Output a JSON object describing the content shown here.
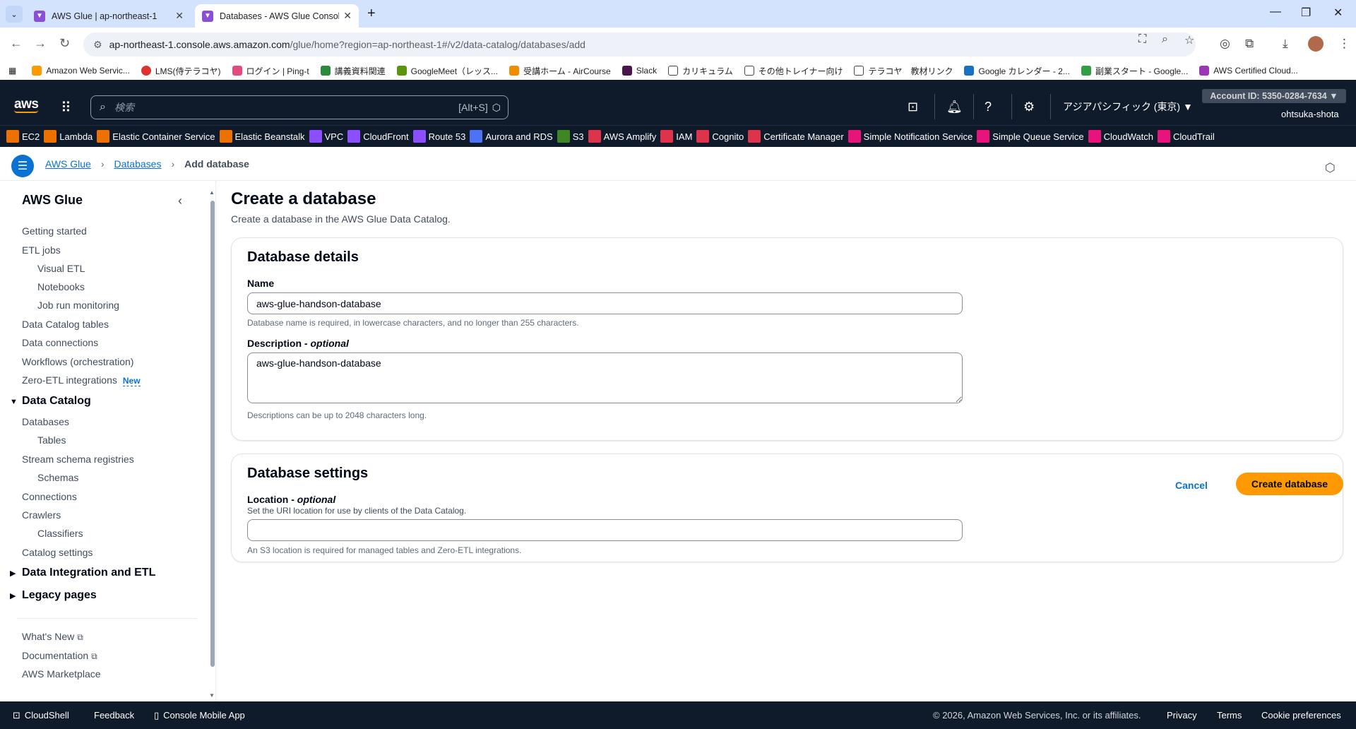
{
  "browser": {
    "tabs": [
      {
        "label": "AWS Glue | ap-northeast-1",
        "active": false
      },
      {
        "label": "Databases - AWS Glue Console",
        "active": true
      }
    ],
    "url_host": "ap-northeast-1.console.aws.amazon.com",
    "url_path": "/glue/home?region=ap-northeast-1#/v2/data-catalog/databases/add",
    "bookmarks": [
      {
        "label": "Amazon Web Servic...",
        "color": "#ff9900"
      },
      {
        "label": "LMS(侍テラコヤ)",
        "color": "#e03131"
      },
      {
        "label": "ログイン | Ping-t",
        "color": "#e64980"
      },
      {
        "label": "講義資料関連",
        "color": "#2b8a3e"
      },
      {
        "label": "GoogleMeet（レッス...",
        "color": "#5c940d"
      },
      {
        "label": "受講ホーム - AirCourse",
        "color": "#f08c00"
      },
      {
        "label": "Slack",
        "color": "#4a154b"
      },
      {
        "label": "カリキュラム",
        "color": "#ffffff"
      },
      {
        "label": "その他トレイナー向け",
        "color": "#ffffff"
      },
      {
        "label": "テラコヤ　教材リンク",
        "color": "#ffffff"
      },
      {
        "label": "Google カレンダー - 2...",
        "color": "#1971c2"
      },
      {
        "label": "副業スタート - Google...",
        "color": "#2f9e44"
      },
      {
        "label": "AWS Certified Cloud...",
        "color": "#9c36b5"
      }
    ]
  },
  "aws_header": {
    "logo": "aws",
    "search_placeholder": "検索",
    "search_shortcut": "[Alt+S]",
    "region": "アジアパシフィック (東京) ▼",
    "account": "Account ID: 5350-0284-7634 ▼",
    "user": "ohtsuka-shota"
  },
  "services": [
    {
      "label": "EC2",
      "color": "#ed7100"
    },
    {
      "label": "Lambda",
      "color": "#ed7100"
    },
    {
      "label": "Elastic Container Service",
      "color": "#ed7100"
    },
    {
      "label": "Elastic Beanstalk",
      "color": "#ed7100"
    },
    {
      "label": "VPC",
      "color": "#8c4fff"
    },
    {
      "label": "CloudFront",
      "color": "#8c4fff"
    },
    {
      "label": "Route 53",
      "color": "#8c4fff"
    },
    {
      "label": "Aurora and RDS",
      "color": "#4d72f3"
    },
    {
      "label": "S3",
      "color": "#3f8624"
    },
    {
      "label": "AWS Amplify",
      "color": "#dd344c"
    },
    {
      "label": "IAM",
      "color": "#dd344c"
    },
    {
      "label": "Cognito",
      "color": "#dd344c"
    },
    {
      "label": "Certificate Manager",
      "color": "#dd344c"
    },
    {
      "label": "Simple Notification Service",
      "color": "#e7157b"
    },
    {
      "label": "Simple Queue Service",
      "color": "#e7157b"
    },
    {
      "label": "CloudWatch",
      "color": "#e7157b"
    },
    {
      "label": "CloudTrail",
      "color": "#e7157b"
    }
  ],
  "breadcrumb": {
    "items": [
      "AWS Glue",
      "Databases"
    ],
    "current": "Add database"
  },
  "sidebar": {
    "title": "AWS Glue",
    "items": [
      {
        "label": "Getting started",
        "level": 0
      },
      {
        "label": "ETL jobs",
        "level": 0
      },
      {
        "label": "Visual ETL",
        "level": 1
      },
      {
        "label": "Notebooks",
        "level": 1
      },
      {
        "label": "Job run monitoring",
        "level": 1
      },
      {
        "label": "Data Catalog tables",
        "level": 0
      },
      {
        "label": "Data connections",
        "level": 0
      },
      {
        "label": "Workflows (orchestration)",
        "level": 0
      },
      {
        "label": "Zero-ETL integrations",
        "level": 0,
        "badge": "New"
      }
    ],
    "group_data_catalog": {
      "label": "Data Catalog",
      "items": [
        {
          "label": "Databases",
          "level": 0
        },
        {
          "label": "Tables",
          "level": 1
        },
        {
          "label": "Stream schema registries",
          "level": 0
        },
        {
          "label": "Schemas",
          "level": 1
        },
        {
          "label": "Connections",
          "level": 0
        },
        {
          "label": "Crawlers",
          "level": 0
        },
        {
          "label": "Classifiers",
          "level": 1
        },
        {
          "label": "Catalog settings",
          "level": 0
        }
      ]
    },
    "group_integration": "Data Integration and ETL",
    "group_legacy": "Legacy pages",
    "links": [
      "What's New",
      "Documentation",
      "AWS Marketplace"
    ]
  },
  "main": {
    "title": "Create a database",
    "description": "Create a database in the AWS Glue Data Catalog.",
    "details": {
      "title": "Database details",
      "name_label": "Name",
      "name_value": "aws-glue-handson-database",
      "name_hint": "Database name is required, in lowercase characters, and no longer than 255 characters.",
      "desc_label": "Description",
      "desc_optional": "optional",
      "desc_value": "aws-glue-handson-database",
      "desc_hint": "Descriptions can be up to 2048 characters long."
    },
    "settings": {
      "title": "Database settings",
      "location_label": "Location",
      "location_optional": "optional",
      "location_desc": "Set the URI location for use by clients of the Data Catalog.",
      "location_value": "",
      "location_hint": "An S3 location is required for managed tables and Zero-ETL integrations."
    },
    "cancel_label": "Cancel",
    "create_label": "Create database"
  },
  "footer": {
    "cloudshell": "CloudShell",
    "feedback": "Feedback",
    "mobile_app": "Console Mobile App",
    "copyright": "© 2026, Amazon Web Services, Inc. or its affiliates.",
    "privacy": "Privacy",
    "terms": "Terms",
    "cookie": "Cookie preferences"
  }
}
